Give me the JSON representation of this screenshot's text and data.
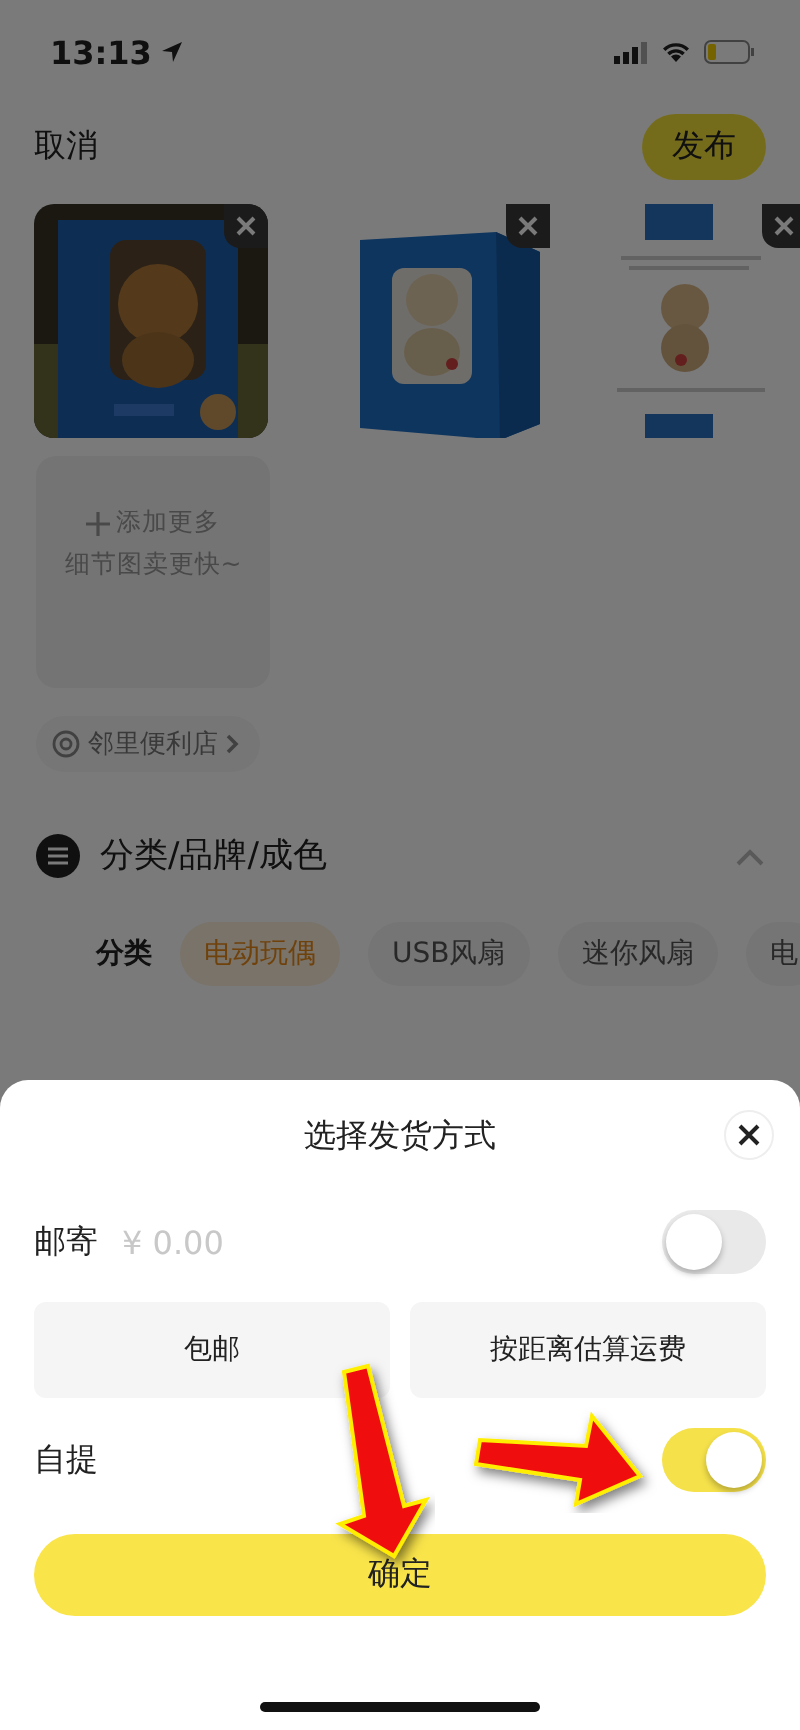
{
  "status_bar": {
    "time": "13:13"
  },
  "header": {
    "cancel": "取消",
    "publish": "发布"
  },
  "add_more": {
    "line_1": "添加更多",
    "line_2": "细节图卖更快~"
  },
  "location": "邻里便利店",
  "section": {
    "title": "分类/品牌/成色",
    "expanded": true
  },
  "category": {
    "label": "分类",
    "chips": [
      {
        "label": "电动玩偶",
        "selected": true
      },
      {
        "label": "USB风扇",
        "selected": false
      },
      {
        "label": "迷你风扇",
        "selected": false
      },
      {
        "label": "电",
        "selected": false
      }
    ]
  },
  "sheet": {
    "title": "选择发货方式",
    "options": [
      {
        "kind": "toggle",
        "label": "邮寄",
        "placeholder": "¥ 0.00",
        "on": false
      },
      {
        "kind": "buttons",
        "buttons": [
          "包邮",
          "按距离估算运费"
        ]
      },
      {
        "kind": "toggle",
        "label": "自提",
        "on": true
      }
    ],
    "confirm": "确定"
  }
}
